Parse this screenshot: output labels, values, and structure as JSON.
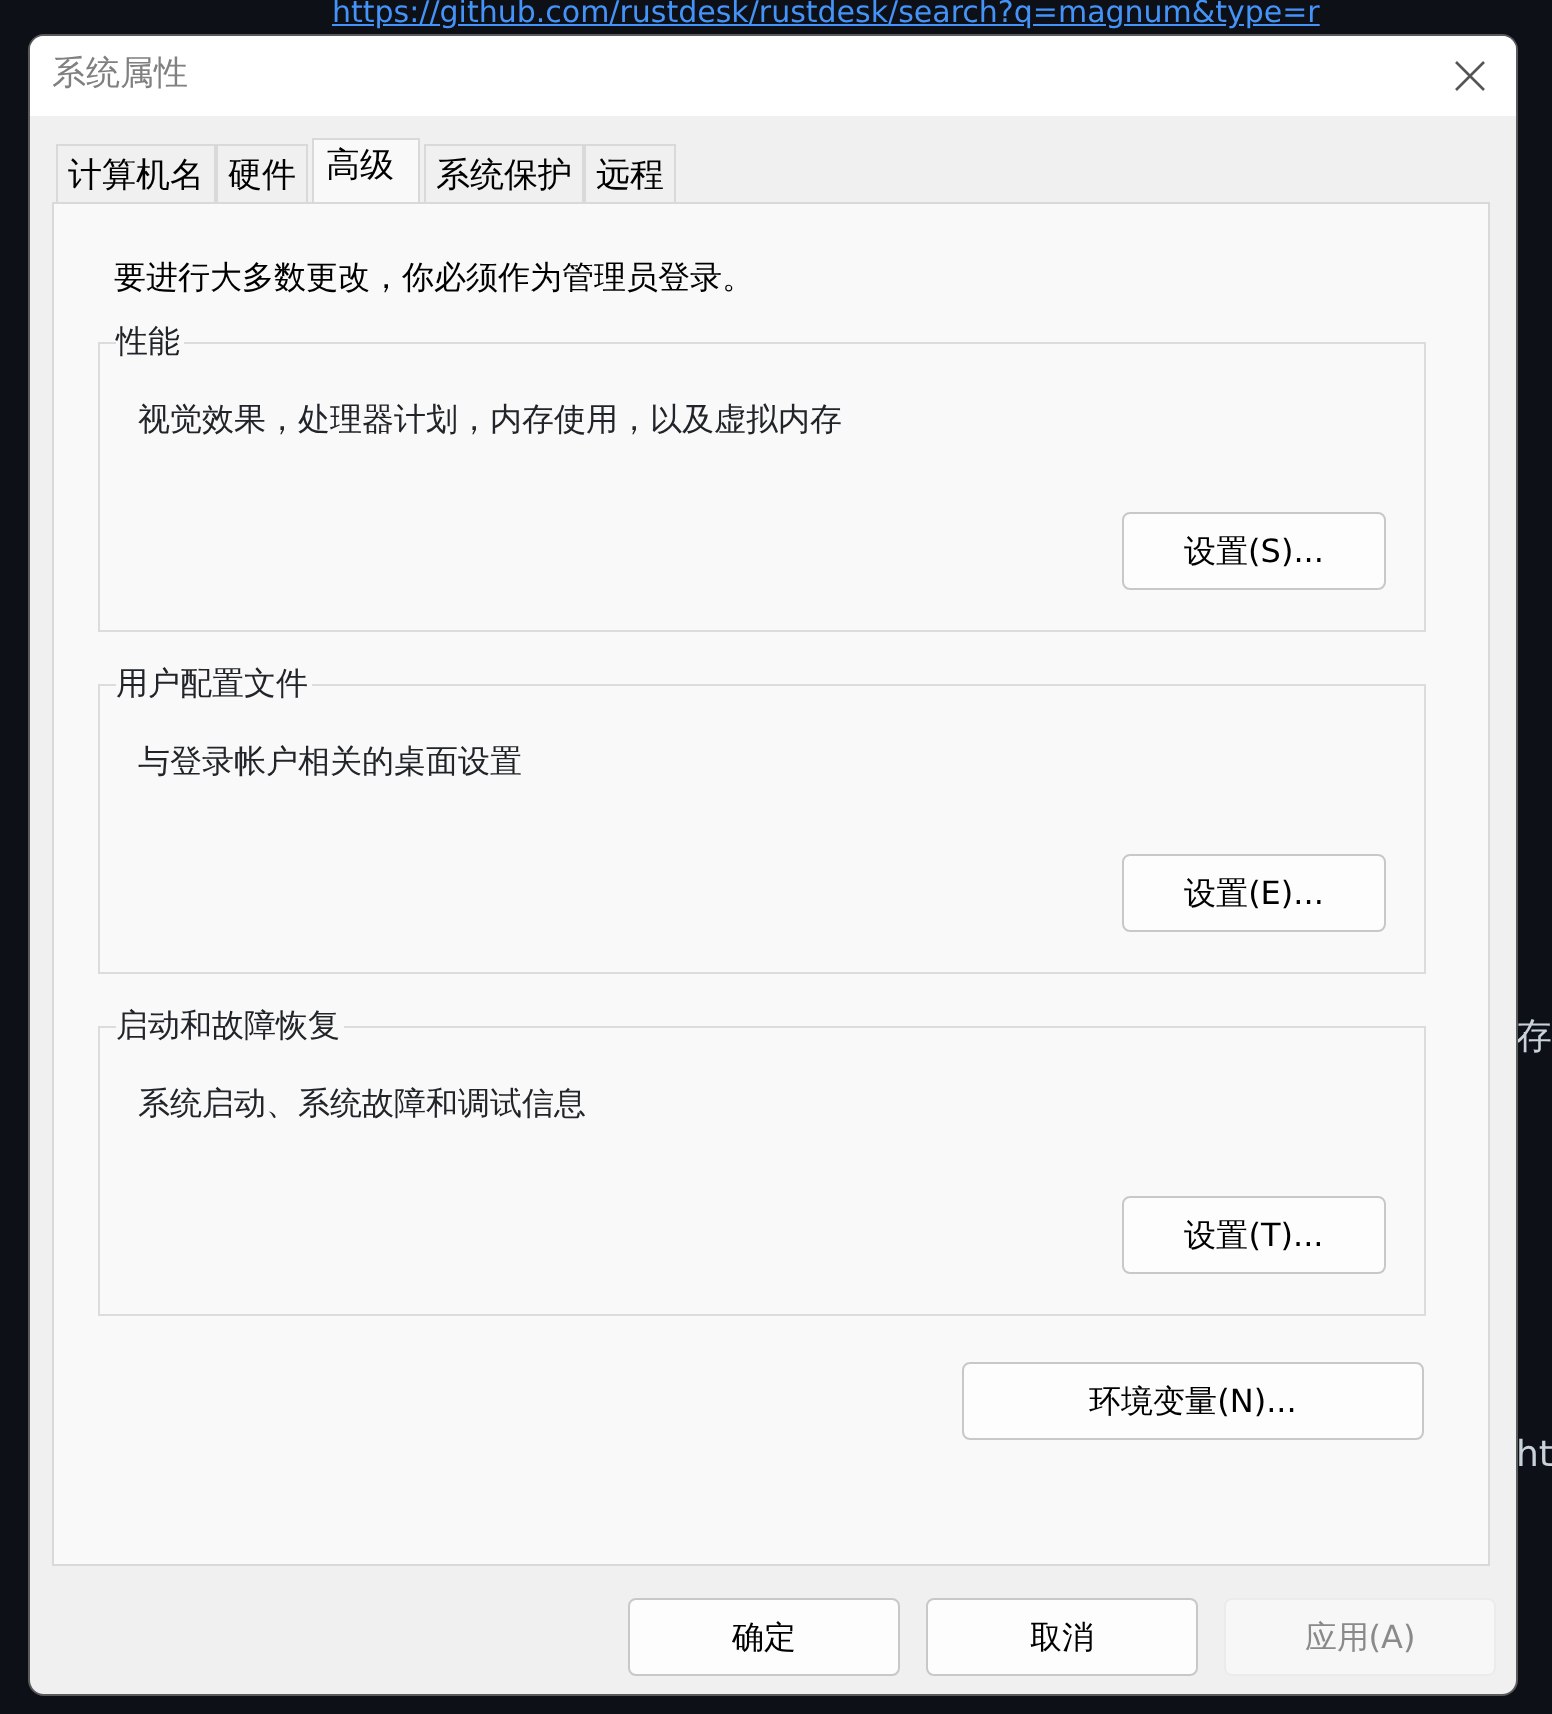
{
  "background": {
    "url_text": "https://github.com/rustdesk/rustdesk/search?q=magnum&type=r",
    "side_texts": [
      "存",
      "ht"
    ]
  },
  "window": {
    "title": "系统属性"
  },
  "tabs": [
    {
      "label": "计算机名",
      "selected": false
    },
    {
      "label": "硬件",
      "selected": false
    },
    {
      "label": "高级",
      "selected": true
    },
    {
      "label": "系统保护",
      "selected": false
    },
    {
      "label": "远程",
      "selected": false
    }
  ],
  "notice": "要进行大多数更改，你必须作为管理员登录。",
  "groups": [
    {
      "title": "性能",
      "description": "视觉效果，处理器计划，内存使用，以及虚拟内存",
      "button": "设置(S)..."
    },
    {
      "title": "用户配置文件",
      "description": "与登录帐户相关的桌面设置",
      "button": "设置(E)..."
    },
    {
      "title": "启动和故障恢复",
      "description": "系统启动、系统故障和调试信息",
      "button": "设置(T)..."
    }
  ],
  "env_button": "环境变量(N)...",
  "buttons": [
    {
      "label": "确定",
      "disabled": false
    },
    {
      "label": "取消",
      "disabled": false
    },
    {
      "label": "应用(A)",
      "disabled": true
    }
  ]
}
